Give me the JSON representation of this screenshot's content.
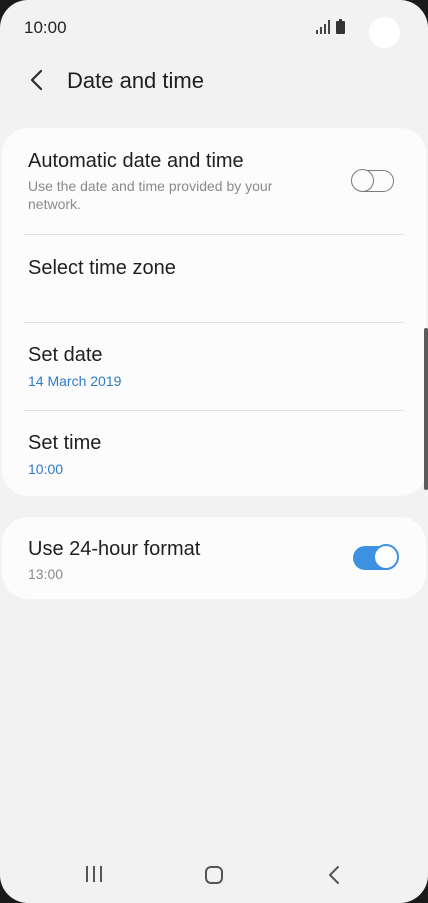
{
  "status_bar": {
    "time": "10:00"
  },
  "header": {
    "title": "Date and time"
  },
  "settings": {
    "automatic": {
      "title": "Automatic date and time",
      "subtitle_line1": "Use the date and time provided by your",
      "subtitle_line2": "network.",
      "enabled": false
    },
    "time_zone": {
      "title": "Select time zone"
    },
    "set_date": {
      "title": "Set date",
      "value": "14 March 2019"
    },
    "set_time": {
      "title": "Set time",
      "value": "10:00"
    },
    "format_24h": {
      "title": "Use 24-hour format",
      "value": "13:00",
      "enabled": true
    }
  },
  "colors": {
    "accent": "#3e91e0",
    "value_text": "#2f7bc4",
    "background": "#f2f2f2",
    "card": "#fcfcfc"
  },
  "icons": [
    "signal-icon",
    "battery-icon",
    "back-icon",
    "recent-apps-icon",
    "home-icon",
    "nav-back-icon"
  ]
}
